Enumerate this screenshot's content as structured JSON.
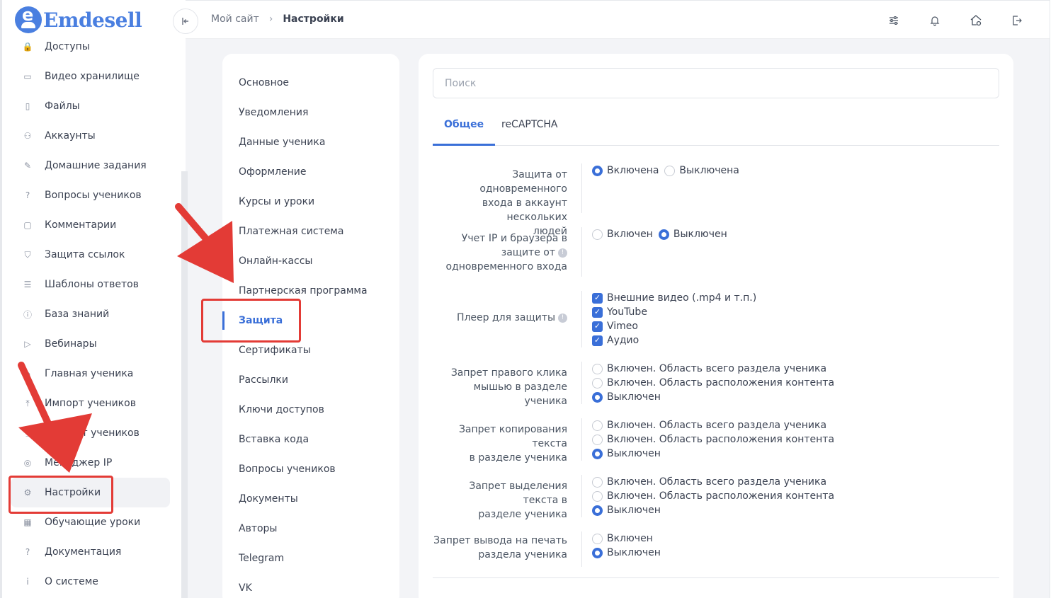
{
  "brand": {
    "name": "Emdesell",
    "badge_letter": "e",
    "color": "#4a7fe0"
  },
  "sidebar": {
    "items": [
      {
        "label": "Доступы",
        "icon": "lock-icon"
      },
      {
        "label": "Видео хранилище",
        "icon": "video-icon"
      },
      {
        "label": "Файлы",
        "icon": "file-icon"
      },
      {
        "label": "Аккаунты",
        "icon": "users-icon"
      },
      {
        "label": "Домашние задания",
        "icon": "pencil-icon"
      },
      {
        "label": "Вопросы учеников",
        "icon": "question-icon"
      },
      {
        "label": "Комментарии",
        "icon": "comment-icon"
      },
      {
        "label": "Защита ссылок",
        "icon": "shield-icon"
      },
      {
        "label": "Шаблоны ответов",
        "icon": "list-icon"
      },
      {
        "label": "База знаний",
        "icon": "info-icon"
      },
      {
        "label": "Вебинары",
        "icon": "play-icon"
      },
      {
        "label": "Главная ученика",
        "icon": "home-icon"
      },
      {
        "label": "Импорт учеников",
        "icon": "upload-icon"
      },
      {
        "label": "Экспорт учеников",
        "icon": "download-icon"
      },
      {
        "label": "Менеджер IP",
        "icon": "target-icon"
      },
      {
        "label": "Настройки",
        "icon": "gear-icon",
        "active": true
      },
      {
        "label": "Обучающие уроки",
        "icon": "film-icon"
      },
      {
        "label": "Документация",
        "icon": "help-box-icon"
      },
      {
        "label": "О системе",
        "icon": "info-box-icon"
      }
    ]
  },
  "header": {
    "breadcrumb": [
      "Мой сайт",
      "Настройки"
    ],
    "icons": [
      "sliders-icon",
      "bell-icon",
      "home-gear-icon",
      "logout-icon"
    ]
  },
  "settings_menu": {
    "items": [
      "Основное",
      "Уведомления",
      "Данные ученика",
      "Оформление",
      "Курсы и уроки",
      "Платежная система",
      "Онлайн-кассы",
      "Партнерская программа",
      "Защита",
      "Сертификаты",
      "Рассылки",
      "Ключи доступов",
      "Вставка кода",
      "Вопросы учеников",
      "Документы",
      "Авторы",
      "Telegram",
      "VK"
    ],
    "active": "Защита"
  },
  "panel": {
    "search_placeholder": "Поиск",
    "tabs": [
      {
        "label": "Общее",
        "active": true
      },
      {
        "label": "reCAPTCHA",
        "active": false
      }
    ],
    "settings": [
      {
        "label_lines": [
          "Защита от одновременного",
          "входа в аккаунт нескольких",
          "людей"
        ],
        "type": "radio-inline",
        "options": [
          "Включена",
          "Выключена"
        ],
        "selected": 0
      },
      {
        "label_lines": [
          "Учет IP и браузера в",
          "защите от",
          "одновременного входа"
        ],
        "info_on_line": 1,
        "type": "radio-inline",
        "options": [
          "Включен",
          "Выключен"
        ],
        "selected": 1
      },
      {
        "label_lines": [
          "Плеер для защиты"
        ],
        "info_on_line": 0,
        "type": "checkbox",
        "options": [
          "Внешние видео (.mp4 и т.п.)",
          "YouTube",
          "Vimeo",
          "Аудио"
        ],
        "checked": [
          true,
          true,
          true,
          true
        ]
      },
      {
        "label_lines": [
          "Запрет правого клика",
          "мышью в разделе ученика"
        ],
        "type": "radio",
        "options": [
          "Включен. Область всего раздела ученика",
          "Включен. Область расположения контента",
          "Выключен"
        ],
        "selected": 2
      },
      {
        "label_lines": [
          "Запрет копирования текста",
          "в разделе ученика"
        ],
        "type": "radio",
        "options": [
          "Включен. Область всего раздела ученика",
          "Включен. Область расположения контента",
          "Выключен"
        ],
        "selected": 2
      },
      {
        "label_lines": [
          "Запрет выделения текста в",
          "разделе ученика"
        ],
        "type": "radio",
        "options": [
          "Включен. Область всего раздела ученика",
          "Включен. Область расположения контента",
          "Выключен"
        ],
        "selected": 2
      },
      {
        "label_lines": [
          "Запрет вывода на печать",
          "раздела ученика"
        ],
        "type": "radio",
        "options": [
          "Включен",
          "Выключен"
        ],
        "selected": 1
      }
    ]
  },
  "annotation_color": "#e33b36"
}
